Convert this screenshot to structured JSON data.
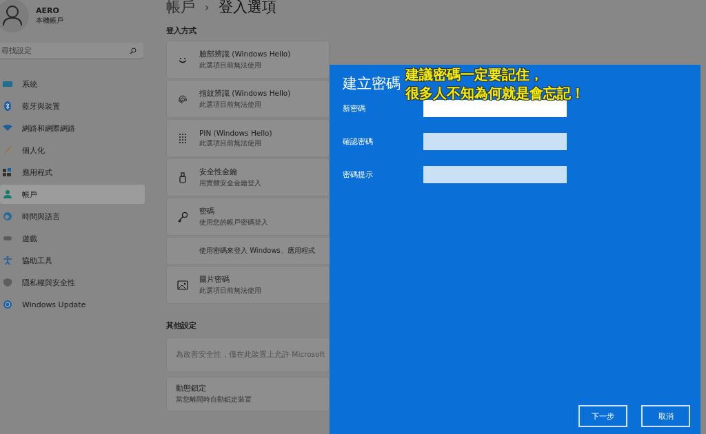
{
  "user": {
    "name": "AERO",
    "account_type": "本機帳戶"
  },
  "search": {
    "placeholder": "尋找設定"
  },
  "sidebar": {
    "items": [
      {
        "kind": "system",
        "label": "系統",
        "selected": false
      },
      {
        "kind": "bluetooth",
        "label": "藍牙與裝置",
        "selected": false
      },
      {
        "kind": "network",
        "label": "網路和網際網路",
        "selected": false
      },
      {
        "kind": "personalize",
        "label": "個人化",
        "selected": false
      },
      {
        "kind": "apps",
        "label": "應用程式",
        "selected": false
      },
      {
        "kind": "accounts",
        "label": "帳戶",
        "selected": true
      },
      {
        "kind": "time",
        "label": "時間與語言",
        "selected": false
      },
      {
        "kind": "gaming",
        "label": "遊戲",
        "selected": false
      },
      {
        "kind": "accessibility",
        "label": "協助工具",
        "selected": false
      },
      {
        "kind": "privacy",
        "label": "隱私權與安全性",
        "selected": false
      },
      {
        "kind": "update",
        "label": "Windows Update",
        "selected": false
      }
    ]
  },
  "breadcrumb": [
    "帳戶",
    "›",
    "登入選項"
  ],
  "sign_in": {
    "heading": "登入方式",
    "options": [
      {
        "kind": "face",
        "title": "臉部辨識 (Windows Hello)",
        "subtitle": "此選項目前無法使用"
      },
      {
        "kind": "fingerprint",
        "title": "指紋辨識 (Windows Hello)",
        "subtitle": "此選項目前無法使用"
      },
      {
        "kind": "pin",
        "title": "PIN (Windows Hello)",
        "subtitle": "此選項目前無法使用"
      },
      {
        "kind": "security_key",
        "title": "安全性金鑰",
        "subtitle": "用實體安全金鑰登入"
      },
      {
        "kind": "password",
        "title": "密碼",
        "subtitle": "使用您的帳戶密碼登入"
      },
      {
        "kind": "detail",
        "title": "使用密碼來登入 Windows、應用程式"
      },
      {
        "kind": "picture",
        "title": "圖片密碼",
        "subtitle": "此選項目前無法使用"
      }
    ]
  },
  "other_settings": {
    "heading": "其他設定",
    "cards": [
      {
        "kind": "note",
        "title": "為改善安全性，僅在此裝置上允許 Microsoft"
      },
      {
        "kind": "setting",
        "title": "動態鎖定",
        "subtitle": "當您離開時自動鎖定裝置"
      }
    ]
  },
  "dialog": {
    "title": "建立密碼",
    "fields": [
      {
        "label": "新密碼",
        "focused": true
      },
      {
        "label": "確認密碼",
        "focused": false
      },
      {
        "label": "密碼提示",
        "focused": false
      }
    ],
    "buttons": [
      "下一步",
      "取消"
    ]
  },
  "annotation": [
    "建議密碼一定要記住，",
    "很多人不知為何就是會忘記！"
  ]
}
